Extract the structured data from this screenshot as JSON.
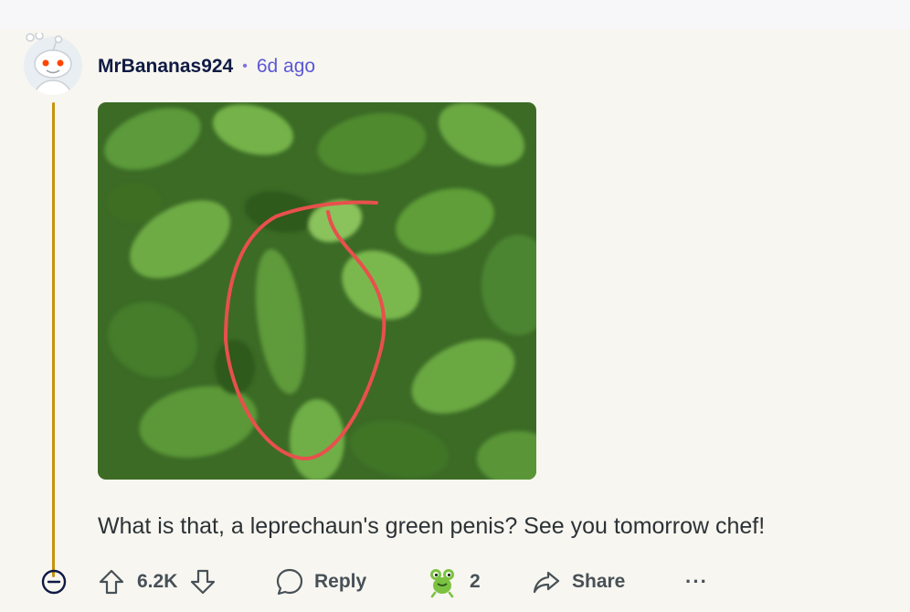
{
  "comment": {
    "username": "MrBananas924",
    "separator": "•",
    "age": "6d ago",
    "body": "What is that, a leprechaun's green penis? See you tomorrow chef!"
  },
  "actions": {
    "score": "6.2K",
    "reply_label": "Reply",
    "award_count": "2",
    "share_label": "Share",
    "more_label": "···"
  },
  "colors": {
    "thread_line": "#c8930a",
    "username": "#0f1a44",
    "timestamp": "#5b58d6",
    "annotation_circle": "#e8504c"
  }
}
